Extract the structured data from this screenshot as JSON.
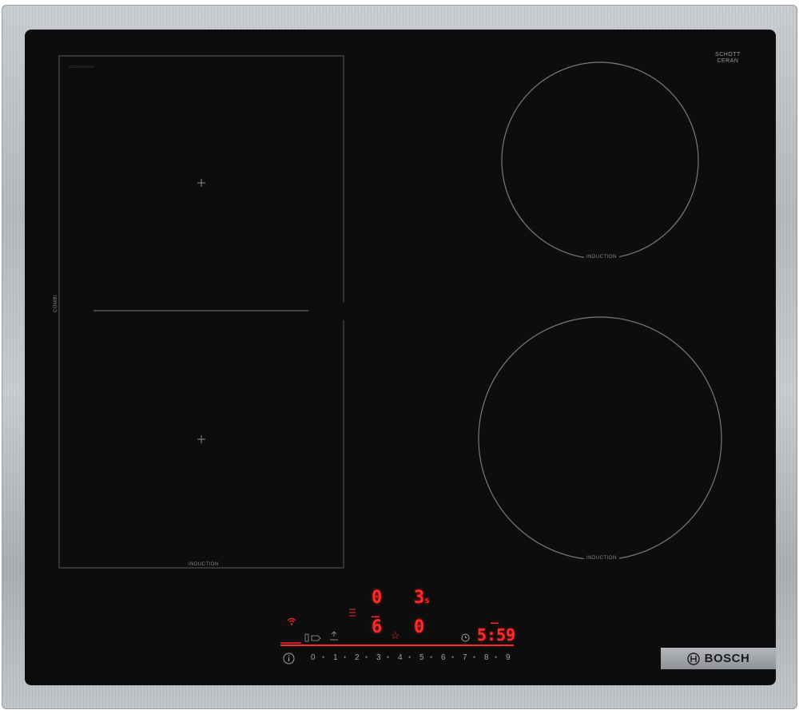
{
  "brand": {
    "name": "BOSCH"
  },
  "glass_logo": {
    "line1": "SCHOTT",
    "line2": "CERAN"
  },
  "zones": {
    "flex": {
      "label": "INDUCTION",
      "side_label": "COMBI"
    },
    "rear_right": {
      "label": "INDUCTION"
    },
    "front_right": {
      "label": "INDUCTION"
    }
  },
  "display": {
    "rear_left_level": "0",
    "rear_right_level": "3",
    "rear_right_suffix": "s",
    "front_left_level": "6",
    "front_right_level": "0",
    "timer": "5:59"
  },
  "icons": {
    "wifi": "wifi-icon",
    "menu": "menu-lines-icon",
    "favorite": "star-icon",
    "timer": "clock-icon",
    "info": "info-icon",
    "sensor": "frying-sensor-icon",
    "boost": "boost-icon",
    "bosch_logo": "bosch-armature-icon"
  },
  "scale": [
    "0",
    "1",
    "2",
    "3",
    "4",
    "5",
    "6",
    "7",
    "8",
    "9"
  ],
  "colors": {
    "glass": "#0d0d0d",
    "led": "#ff2a2a",
    "frame": "#b8bcc1",
    "badge": "#9c9fa3"
  }
}
